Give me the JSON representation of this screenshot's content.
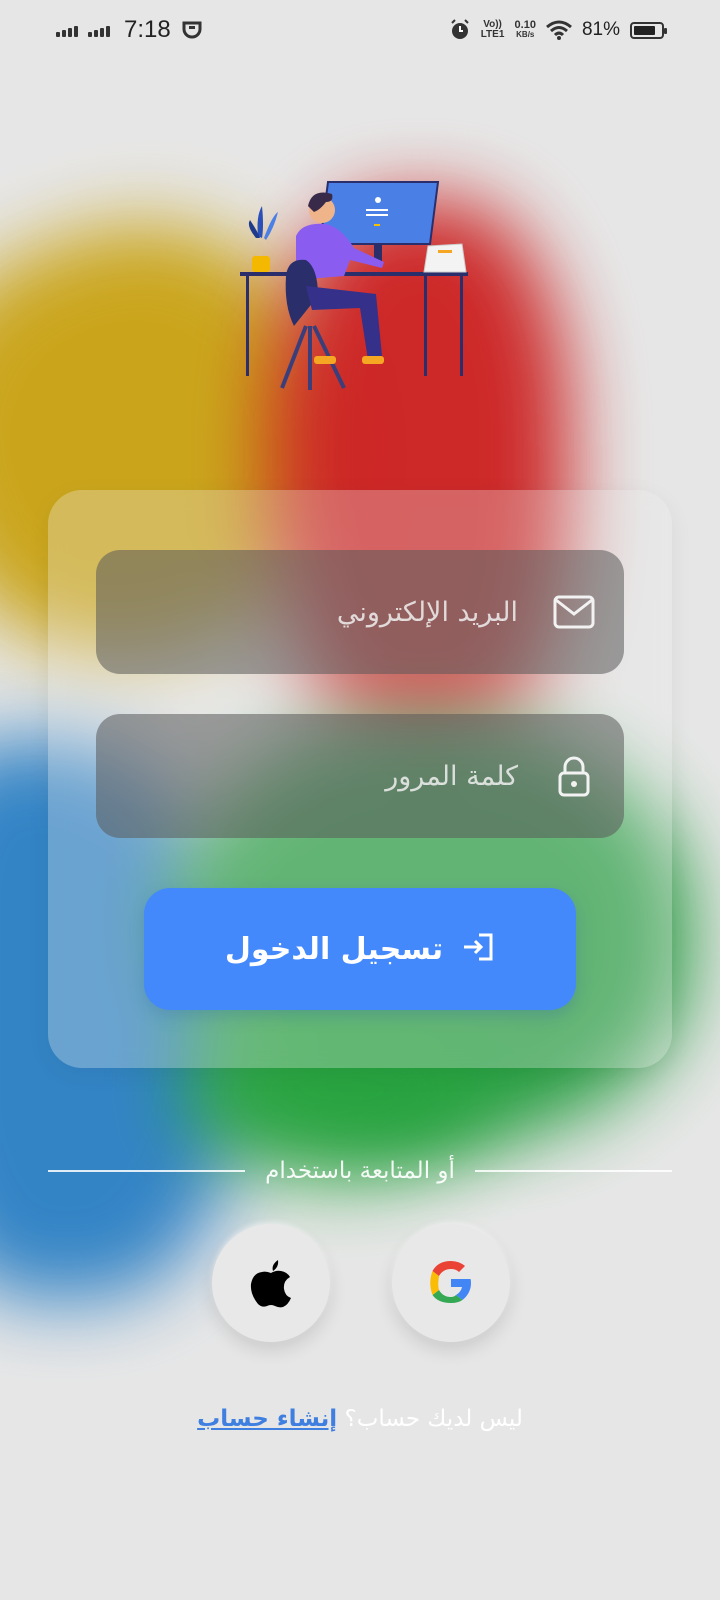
{
  "status_bar": {
    "time": "7:18",
    "volte": "Vo)) LTE1",
    "speed_value": "0.10",
    "speed_unit": "KB/s",
    "battery": "81%",
    "battery_level": 0.81
  },
  "login": {
    "email_placeholder": "البريد الإلكتروني",
    "password_placeholder": "كلمة المرور",
    "login_label": "تسجيل الدخول",
    "divider_text": "أو المتابعة باستخدام",
    "signup_question": "ليس لديك حساب؟",
    "signup_link": "إنشاء حساب"
  },
  "colors": {
    "accent": "#4389fb",
    "link": "#3f7fe0",
    "background": "#e6e6e6"
  },
  "icons": {
    "email": "mail-icon",
    "password": "lock-icon",
    "login": "login-icon",
    "apple": "apple-icon",
    "google": "google-icon"
  }
}
